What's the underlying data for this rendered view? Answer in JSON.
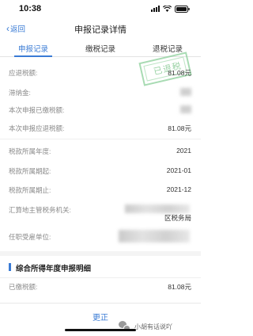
{
  "status_bar": {
    "time": "10:38"
  },
  "nav": {
    "back_label": "返回",
    "title": "申报记录详情"
  },
  "tabs": [
    {
      "label": "申报记录",
      "active": true
    },
    {
      "label": "缴税记录",
      "active": false
    },
    {
      "label": "退税记录",
      "active": false
    }
  ],
  "stamp": {
    "text": "已退税"
  },
  "rows_top": [
    {
      "label": "应退税额:",
      "value": "81.08元"
    },
    {
      "label": "滞纳金:",
      "value": ""
    },
    {
      "label": "本次申报已缴税额:",
      "value": ""
    },
    {
      "label": "本次申报应退税额:",
      "value": "81.08元"
    }
  ],
  "rows_period": [
    {
      "label": "税款所属年度:",
      "value": "2021"
    },
    {
      "label": "税款所属期起:",
      "value": "2021-01"
    },
    {
      "label": "税款所属期止:",
      "value": "2021-12"
    }
  ],
  "tax_authority": {
    "label": "汇算地主管税务机关:",
    "value": "区税务局"
  },
  "employer": {
    "label": "任职受雇单位:",
    "value": ""
  },
  "section": {
    "title": "综合所得年度申报明细"
  },
  "paid": {
    "label": "已缴税额:",
    "value": "81.08元"
  },
  "footer": {
    "button_label": "更正",
    "watermark": "小胡有话说吖"
  },
  "colors": {
    "accent": "#3a7bd5",
    "stamp": "#79c487"
  }
}
